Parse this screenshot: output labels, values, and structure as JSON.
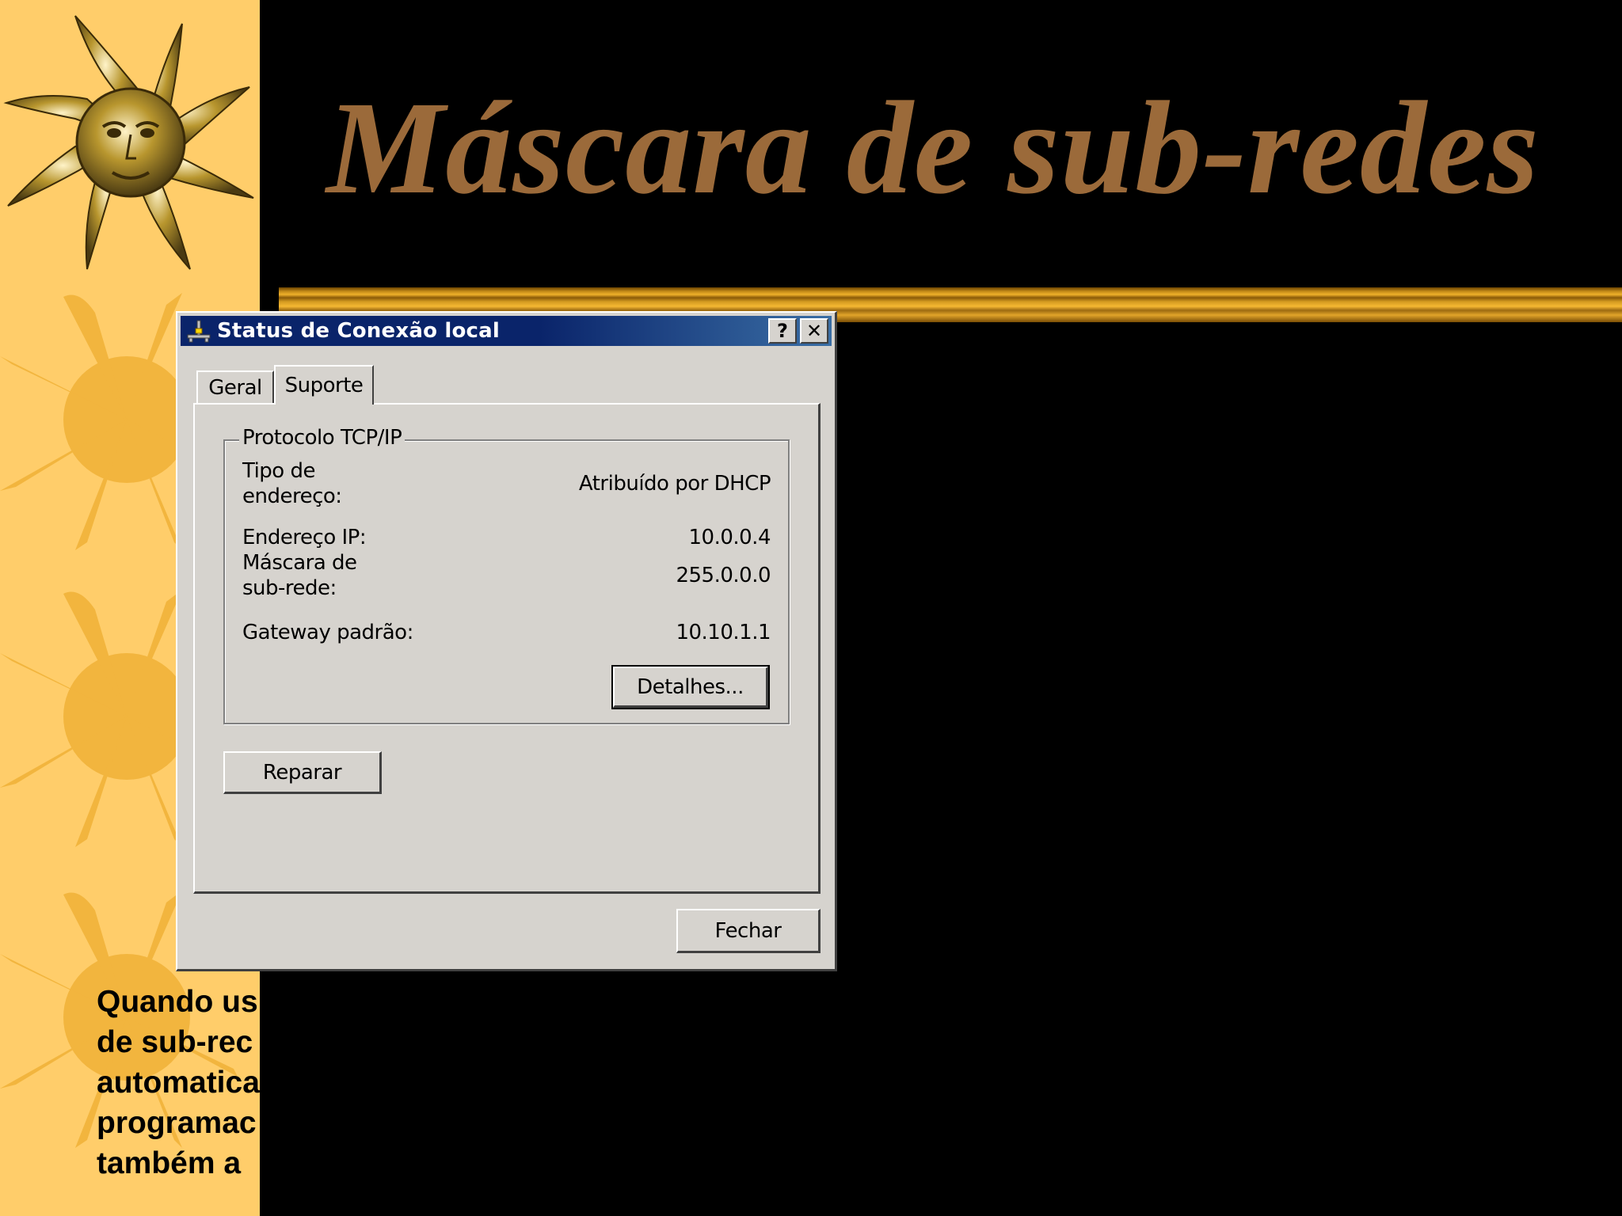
{
  "slide": {
    "title": "Máscara de sub-redes",
    "body_lines": [
      "Quando us",
      "de sub-rec",
      "automatica",
      "programac",
      "também a "
    ]
  },
  "colors": {
    "band": "#ffcd6a",
    "title": "#9b6a3a",
    "titlebar_start": "#0a246a",
    "titlebar_end": "#3a6ea5",
    "dialog_face": "#d6d3ce"
  },
  "dialog": {
    "title": "Status de Conexão local",
    "icon": "network-connection-icon",
    "help_label": "?",
    "close_label": "✕",
    "tabs": [
      {
        "label": "Geral",
        "active": false
      },
      {
        "label": "Suporte",
        "active": true
      }
    ],
    "group": {
      "legend": "Protocolo TCP/IP",
      "rows": [
        {
          "label": "Tipo de endereço:",
          "value": "Atribuído por DHCP"
        },
        {
          "label": "Endereço IP:",
          "value": "10.0.0.4"
        },
        {
          "label": "Máscara de sub-rede:",
          "value": "255.0.0.0"
        },
        {
          "label": "Gateway padrão:",
          "value": "10.10.1.1"
        }
      ],
      "details_button": "Detalhes..."
    },
    "repair_button": "Reparar",
    "close_button": "Fechar"
  }
}
